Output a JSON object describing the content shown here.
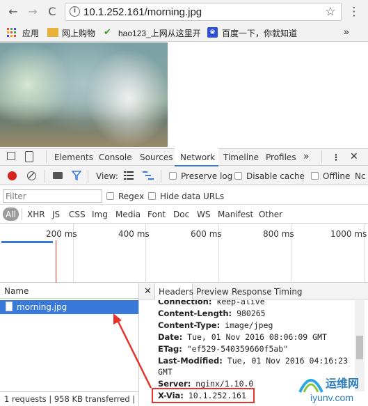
{
  "browser": {
    "url": "10.1.252.161/morning.jpg",
    "back": "←",
    "forward": "→",
    "reload": "C",
    "star": "☆",
    "menu": "⋮",
    "more": "»"
  },
  "bookmarks": [
    {
      "label": "应用",
      "icon": "apps-grid-icon"
    },
    {
      "label": "网上购物",
      "icon": "folder-icon"
    },
    {
      "label": "hao123_上网从这里开",
      "icon": "hao123-icon"
    },
    {
      "label": "百度一下，你就知道",
      "icon": "baidu-paw-icon"
    }
  ],
  "devtools": {
    "tabs": [
      "Elements",
      "Console",
      "Sources",
      "Network",
      "Timeline",
      "Profiles"
    ],
    "active_tab": "Network",
    "overflow": "»",
    "close": "✕",
    "network_toolbar": {
      "view_label": "View:",
      "preserve_log": "Preserve log",
      "disable_cache": "Disable cache",
      "offline": "Offline",
      "throttle": "Nc"
    },
    "filter": {
      "placeholder": "Filter",
      "regex": "Regex",
      "hide_data_urls": "Hide data URLs"
    },
    "types": [
      "All",
      "XHR",
      "JS",
      "CSS",
      "Img",
      "Media",
      "Font",
      "Doc",
      "WS",
      "Manifest",
      "Other"
    ],
    "timeline_ticks": [
      "200 ms",
      "400 ms",
      "600 ms",
      "800 ms",
      "1000 ms"
    ],
    "name_column": "Name",
    "requests": [
      {
        "name": "morning.jpg"
      }
    ],
    "status": "1 requests  |  958 KB transferred  |",
    "detail_tabs": [
      "Headers",
      "Preview",
      "Response",
      "Timing"
    ],
    "active_detail": "Headers",
    "detail_close": "✕",
    "headers": [
      {
        "key": "Connection:",
        "value": "keep-alive"
      },
      {
        "key": "Content-Length:",
        "value": "980265"
      },
      {
        "key": "Content-Type:",
        "value": "image/jpeg"
      },
      {
        "key": "Date:",
        "value": "Tue, 01 Nov 2016 08:06:09 GMT"
      },
      {
        "key": "ETag:",
        "value": "\"ef529-540359660f5ab\""
      },
      {
        "key": "Last-Modified:",
        "value": "Tue, 01 Nov 2016 04:16:23"
      },
      {
        "key": "",
        "value": "GMT"
      },
      {
        "key": "Server:",
        "value": "nginx/1.10.0"
      },
      {
        "key": "X-Via:",
        "value": "10.1.252.161"
      }
    ]
  },
  "watermark": {
    "text": "运维网",
    "url": "iyunv.com"
  },
  "colors": {
    "highlight_box": "#e8312a",
    "accent": "#3879d9"
  }
}
